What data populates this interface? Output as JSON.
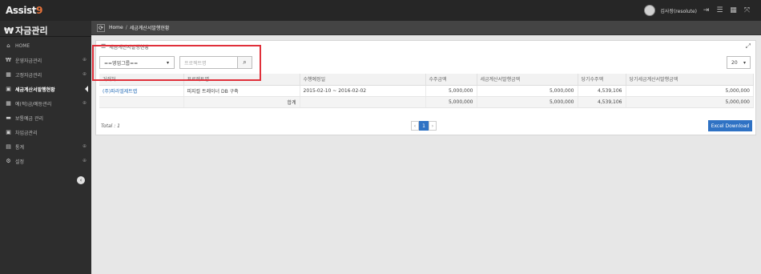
{
  "app": {
    "brand_main": "Assist",
    "brand_accent": "9",
    "user_label": "김사장(resolute)"
  },
  "sidebar": {
    "title_icon": "₩",
    "title": "자금관리",
    "items": [
      {
        "label": "HOME",
        "icon": "home-icon",
        "glyph": "⌂",
        "plus": ""
      },
      {
        "label": "운영자금관리",
        "icon": "won-icon",
        "glyph": "₩",
        "plus": "⊕"
      },
      {
        "label": "고정자금관리",
        "icon": "calendar-icon",
        "glyph": "▦",
        "plus": "⊕"
      },
      {
        "label": "세금계산서발행현황",
        "icon": "invoice-icon",
        "glyph": "▣",
        "plus": ""
      },
      {
        "label": "예(적)금/예등관리",
        "icon": "calendar-icon",
        "glyph": "▦",
        "plus": "⊕"
      },
      {
        "label": "보통예금 관리",
        "icon": "car-icon",
        "glyph": "▬",
        "plus": ""
      },
      {
        "label": "차입금관리",
        "icon": "invoice-icon",
        "glyph": "▣",
        "plus": ""
      },
      {
        "label": "통계",
        "icon": "chart-icon",
        "glyph": "▤",
        "plus": "⊕"
      },
      {
        "label": "설정",
        "icon": "gears-icon",
        "glyph": "⚙",
        "plus": "⊕"
      }
    ],
    "active_index": 3
  },
  "breadcrumb": {
    "home": "Home",
    "separator": "/",
    "current": "세금계산서발행현황"
  },
  "panel": {
    "title": "세금계산서발행현황",
    "group_select": "==영업그룹==",
    "search_placeholder": "프로젝트명",
    "page_size": "20"
  },
  "table": {
    "columns": [
      "거래처",
      "프로젝트명",
      "수행예정일",
      "수주금액",
      "세금계산서발행금액",
      "당기수주액",
      "당기세금계산서발행금액"
    ],
    "rows": [
      [
        "(주)파라엘제트랩",
        "피지컬 트레이너 DB 구축",
        "2015-02-10 ~ 2016-02-02",
        "5,000,000",
        "5,000,000",
        "4,539,106",
        "5,000,000"
      ]
    ],
    "sum_label": "합계",
    "sum_values": [
      "5,000,000",
      "5,000,000",
      "4,539,106",
      "5,000,000"
    ]
  },
  "footer": {
    "total": "Total : 1",
    "prev": "‹",
    "page": "1",
    "next": "›",
    "excel_button": "Excel Download"
  }
}
